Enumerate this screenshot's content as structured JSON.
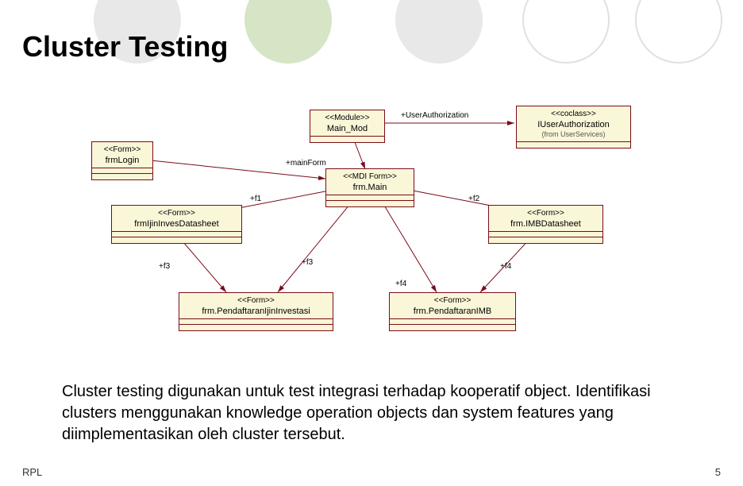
{
  "slide": {
    "title": "Cluster Testing",
    "body": "Cluster testing digunakan untuk test integrasi terhadap kooperatif object. Identifikasi clusters menggunakan knowledge operation objects dan system features yang diimplementasikan oleh cluster tersebut.",
    "footer_left": "RPL",
    "footer_right": "5"
  },
  "diagram": {
    "nodes": {
      "main_mod": {
        "stereo": "<<Module>>",
        "name": "Main_Mod"
      },
      "user_auth": {
        "stereo": "<<coclass>>",
        "name": "IUserAuthorization",
        "from": "(from UserServices)"
      },
      "frm_login": {
        "stereo": "<<Form>>",
        "name": "frmLogin"
      },
      "frm_main": {
        "stereo": "<<MDI Form>>",
        "name": "frm.Main"
      },
      "frm_ijin_inves": {
        "stereo": "<<Form>>",
        "name": "frmIjinInvesDatasheet"
      },
      "frm_imb_ds": {
        "stereo": "<<Form>>",
        "name": "frm.IMBDatasheet"
      },
      "frm_pendaftaran_inv": {
        "stereo": "<<Form>>",
        "name": "frm.PendaftaranIjinInvestasi"
      },
      "frm_pendaftaran_imb": {
        "stereo": "<<Form>>",
        "name": "frm.PendaftaranIMB"
      }
    },
    "edges": {
      "e_userauth": "+UserAuthorization",
      "e_mainform": "+mainForm",
      "e_f1": "+f1",
      "e_f2": "+f2",
      "e_f3a": "+f3",
      "e_f3b": "+f3",
      "e_f4a": "+f4",
      "e_f4b": "+f4"
    }
  }
}
